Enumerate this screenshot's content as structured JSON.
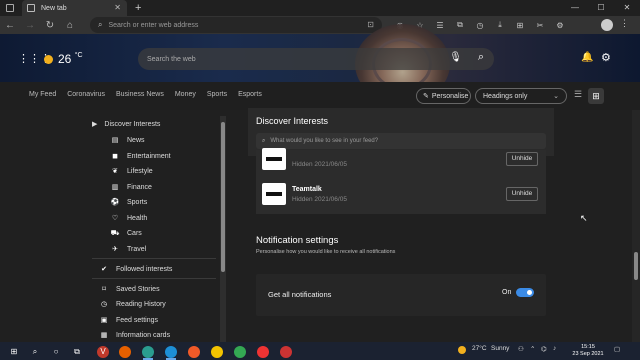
{
  "browser": {
    "tab_title": "New tab",
    "new_tab": "+",
    "address_placeholder": "Search or enter web address",
    "window_controls": [
      "—",
      "☐",
      "✕"
    ]
  },
  "banner": {
    "temperature": "26",
    "temperature_unit": "°C",
    "search_placeholder": "Search the web"
  },
  "feed_nav": {
    "items": [
      "My Feed",
      "Coronavirus",
      "Business News",
      "Money",
      "Sports",
      "Esports"
    ],
    "personalise_label": "Personalise",
    "layout_select": "Headings only"
  },
  "sidebar": {
    "discover": "Discover Interests",
    "categories": [
      "News",
      "Entertainment",
      "Lifestyle",
      "Finance",
      "Sports",
      "Health",
      "Cars",
      "Travel"
    ],
    "followed": "Followed interests",
    "links": [
      "Saved Stories",
      "Reading History",
      "Feed settings",
      "Information cards"
    ]
  },
  "panel": {
    "title": "Discover Interests",
    "search_placeholder": "What would you like to see in your feed?",
    "hidden_sources": [
      {
        "name": "",
        "date": "Hidden 2021/06/05",
        "button": "Unhide"
      },
      {
        "name": "Teamtalk",
        "date": "Hidden 2021/06/05",
        "button": "Unhide"
      }
    ]
  },
  "notifications": {
    "title": "Notification settings",
    "subtitle": "Personalise how you would like to receive all notifications",
    "label": "Get all notifications",
    "state": "On"
  },
  "taskbar": {
    "weather_temp": "27°C",
    "weather_desc": "Sunny",
    "time": "15:15",
    "date": "23 Sep 2021"
  },
  "colors": {
    "accent": "#3b8be6",
    "toolbar": "#333333",
    "background": "#202020"
  }
}
